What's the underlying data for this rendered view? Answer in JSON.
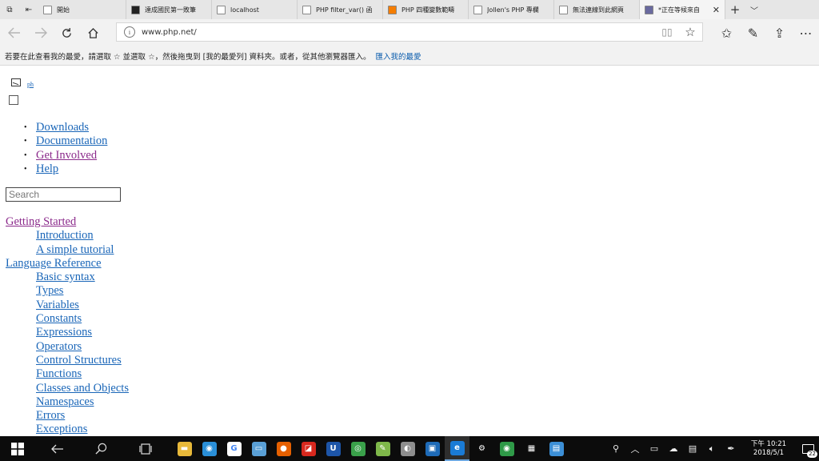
{
  "tabs": [
    {
      "label": "開始",
      "favicon": "start-favicon",
      "color": "#ffffff"
    },
    {
      "label": "達成國民第一敗筆",
      "favicon": "flag-favicon",
      "color": "#222222"
    },
    {
      "label": "localhost",
      "favicon": "page-favicon",
      "color": "#ffffff"
    },
    {
      "label": "PHP filter_var() 函",
      "favicon": "page-favicon",
      "color": "#ffffff"
    },
    {
      "label": "PHP 四種變數範疇",
      "favicon": "blogger-favicon",
      "color": "#f57d00"
    },
    {
      "label": "Jollen's PHP 專欄",
      "favicon": "page-favicon",
      "color": "#ffffff"
    },
    {
      "label": "無法連線到此網頁",
      "favicon": "page-favicon",
      "color": "#ffffff"
    },
    {
      "label": "*正在等候來自",
      "favicon": "php-favicon",
      "color": "#6a6a9f",
      "active": true
    }
  ],
  "address": {
    "url": "www.php.net/"
  },
  "favorites_bar": {
    "message": "若要在此查看我的最愛，請選取 ☆ 並選取 ☆，然後拖曳到 [我的最愛列] 資料夾。或者，從其他瀏覽器匯入。",
    "import_link": "匯入我的最愛"
  },
  "page": {
    "logo_alt": "ph",
    "search_placeholder": "Search",
    "main_menu": [
      {
        "label": "Downloads",
        "visited": false
      },
      {
        "label": "Documentation",
        "visited": false
      },
      {
        "label": "Get Involved",
        "visited": true
      },
      {
        "label": "Help",
        "visited": false
      }
    ],
    "toc": [
      {
        "section": "Getting Started",
        "visited": true,
        "items": [
          "Introduction",
          "A simple tutorial"
        ]
      },
      {
        "section": "Language Reference",
        "visited": false,
        "items": [
          "Basic syntax",
          "Types",
          "Variables",
          "Constants",
          "Expressions",
          "Operators",
          "Control Structures",
          "Functions",
          "Classes and Objects",
          "Namespaces",
          "Errors",
          "Exceptions"
        ]
      }
    ]
  },
  "taskbar": {
    "apps": [
      {
        "name": "file-explorer-icon",
        "color": "#e8b93a",
        "glyph": "▬"
      },
      {
        "name": "camera-app-icon",
        "color": "#2a8fd8",
        "glyph": "◉"
      },
      {
        "name": "google-icon",
        "color": "#ffffff",
        "glyph": "G"
      },
      {
        "name": "notes-app-icon",
        "color": "#5aa0d6",
        "glyph": "▭"
      },
      {
        "name": "firefox-icon",
        "color": "#e66000",
        "glyph": "●"
      },
      {
        "name": "pdf-app-icon",
        "color": "#d8281e",
        "glyph": "◪"
      },
      {
        "name": "u-app-icon",
        "color": "#1d55a8",
        "glyph": "U"
      },
      {
        "name": "globe-app-icon",
        "color": "#3aa14a",
        "glyph": "◎"
      },
      {
        "name": "notepad-app-icon",
        "color": "#7fb84a",
        "glyph": "✎"
      },
      {
        "name": "paint-app-icon",
        "color": "#8e8e8e",
        "glyph": "◐"
      },
      {
        "name": "window-app-icon",
        "color": "#1e6bb8",
        "glyph": "▣"
      },
      {
        "name": "edge-icon",
        "color": "#1a7bd6",
        "glyph": "e",
        "active": true
      },
      {
        "name": "settings-icon",
        "color": "#0c0c0c",
        "glyph": "⚙"
      },
      {
        "name": "chrome-icon",
        "color": "#2f9a48",
        "glyph": "◉"
      },
      {
        "name": "security-icon",
        "color": "#0c0c0c",
        "glyph": "▦"
      },
      {
        "name": "photo-app-icon",
        "color": "#3c8fd6",
        "glyph": "▤"
      }
    ],
    "clock_time": "下午 10:21",
    "clock_date": "2018/5/1",
    "notification_count": "22"
  }
}
